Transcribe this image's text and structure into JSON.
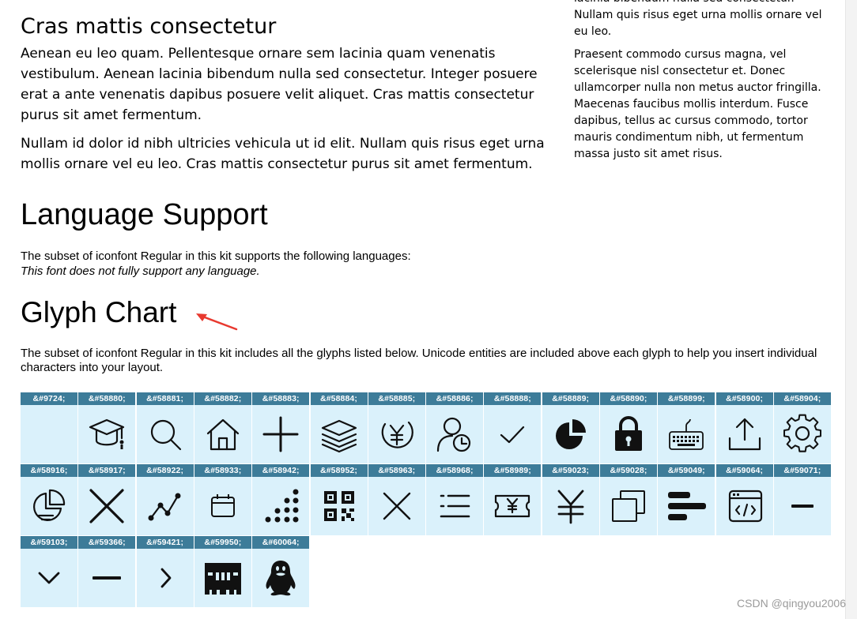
{
  "side": {
    "p0_partial": "lacinia bibendum nulla sed consectetur.",
    "p0": "Nullam quis risus eget urna mollis ornare vel eu leo.",
    "p1": "Praesent commodo cursus magna, vel scelerisque nisl consectetur et. Donec ullamcorper nulla non metus auctor fringilla. Maecenas faucibus mollis interdum. Fusce dapibus, tellus ac cursus commodo, tortor mauris condimentum nibh, ut fermentum massa justo sit amet risus."
  },
  "cras": {
    "heading": "Cras mattis consectetur",
    "p1": "Aenean eu leo quam. Pellentesque ornare sem lacinia quam venenatis vestibulum. Aenean lacinia bibendum nulla sed consectetur. Integer posuere erat a ante venenatis dapibus posuere velit aliquet. Cras mattis consectetur purus sit amet fermentum.",
    "p2": "Nullam id dolor id nibh ultricies vehicula ut id elit. Nullam quis risus eget urna mollis ornare vel eu leo. Cras mattis consectetur purus sit amet fermentum."
  },
  "language": {
    "heading": "Language Support",
    "desc": "The subset of iconfont Regular in this kit supports the following languages:",
    "note": "This font does not fully support any language."
  },
  "glyph_chart": {
    "heading": "Glyph Chart",
    "desc": "The subset of iconfont Regular in this kit includes all the glyphs listed below. Unicode entities are included above each glyph to help you insert individual characters into your layout.",
    "accent_color": "#3d7c99",
    "cell_bg": "#daf1fb",
    "glyphs": [
      {
        "code": "&#9724;",
        "icon": "blank-icon"
      },
      {
        "code": "&#58880;",
        "icon": "graduation-cap-icon"
      },
      {
        "code": "&#58881;",
        "icon": "search-icon"
      },
      {
        "code": "&#58882;",
        "icon": "home-icon"
      },
      {
        "code": "&#58883;",
        "icon": "plus-icon"
      },
      {
        "code": "&#58884;",
        "icon": "layers-icon"
      },
      {
        "code": "&#58885;",
        "icon": "yen-circle-icon"
      },
      {
        "code": "&#58886;",
        "icon": "user-clock-icon"
      },
      {
        "code": "&#58888;",
        "icon": "check-icon"
      },
      {
        "code": "&#58889;",
        "icon": "pie-chart-icon"
      },
      {
        "code": "&#58890;",
        "icon": "lock-icon"
      },
      {
        "code": "&#58899;",
        "icon": "keyboard-icon"
      },
      {
        "code": "&#58900;",
        "icon": "upload-icon"
      },
      {
        "code": "&#58904;",
        "icon": "gear-icon"
      },
      {
        "code": "&#58916;",
        "icon": "pie-outline-icon"
      },
      {
        "code": "&#58917;",
        "icon": "close-large-icon"
      },
      {
        "code": "&#58922;",
        "icon": "line-chart-icon"
      },
      {
        "code": "&#58933;",
        "icon": "calendar-icon"
      },
      {
        "code": "&#58942;",
        "icon": "scatter-icon"
      },
      {
        "code": "&#58952;",
        "icon": "qr-code-icon"
      },
      {
        "code": "&#58963;",
        "icon": "close-icon"
      },
      {
        "code": "&#58968;",
        "icon": "list-icon"
      },
      {
        "code": "&#58989;",
        "icon": "ticket-yen-icon"
      },
      {
        "code": "&#59023;",
        "icon": "yen-icon"
      },
      {
        "code": "&#59028;",
        "icon": "copy-icon"
      },
      {
        "code": "&#59049;",
        "icon": "bar-align-left-icon"
      },
      {
        "code": "&#59064;",
        "icon": "code-window-icon"
      },
      {
        "code": "&#59071;",
        "icon": "minus-small-icon"
      },
      {
        "code": "&#59103;",
        "icon": "chevron-down-icon"
      },
      {
        "code": "&#59366;",
        "icon": "minus-icon"
      },
      {
        "code": "&#59421;",
        "icon": "chevron-right-icon"
      },
      {
        "code": "&#59950;",
        "icon": "memory-chip-icon"
      },
      {
        "code": "&#60064;",
        "icon": "penguin-icon"
      }
    ]
  },
  "watermark": "CSDN @qingyou2006"
}
